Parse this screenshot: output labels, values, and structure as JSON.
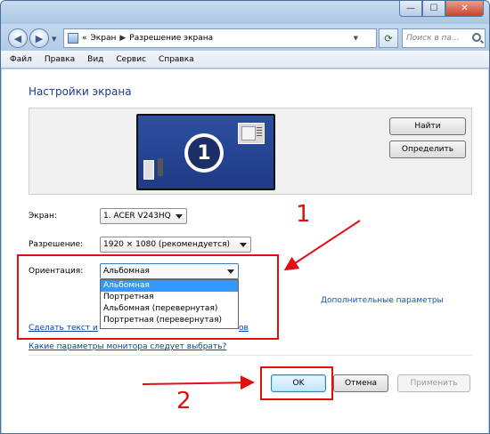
{
  "window": {
    "caption": {
      "minimize": "—",
      "maximize": "☐",
      "close": "✕"
    }
  },
  "navigation": {
    "breadcrumb_prefix": "«",
    "breadcrumb": [
      "Экран",
      "Разрешение экрана"
    ],
    "search_placeholder": "Поиск в па..."
  },
  "menu": [
    "Файл",
    "Правка",
    "Вид",
    "Сервис",
    "Справка"
  ],
  "main": {
    "title": "Настройки экрана",
    "monitor_number": "1",
    "buttons": {
      "find": "Найти",
      "detect": "Определить"
    },
    "fields": {
      "screen": {
        "label": "Экран:",
        "value": "1. ACER V243HQ"
      },
      "resolution": {
        "label": "Разрешение:",
        "value": "1920 × 1080 (рекомендуется)"
      },
      "orientation": {
        "label": "Ориентация:",
        "value": "Альбомная",
        "options": [
          "Альбомная",
          "Портретная",
          "Альбомная (перевернутая)",
          "Портретная (перевернутая)"
        ]
      }
    },
    "links": {
      "advanced": "Дополнительные параметры",
      "text_size": "Сделать текст и други",
      "text_size_tail": "ов",
      "monitor_params": "Какие параметры монитора следует выбрать?"
    },
    "dialog_buttons": {
      "ok": "OK",
      "cancel": "Отмена",
      "apply": "Применить"
    }
  },
  "annotations": {
    "label_1": "1",
    "label_2": "2",
    "color": "#e01010"
  }
}
